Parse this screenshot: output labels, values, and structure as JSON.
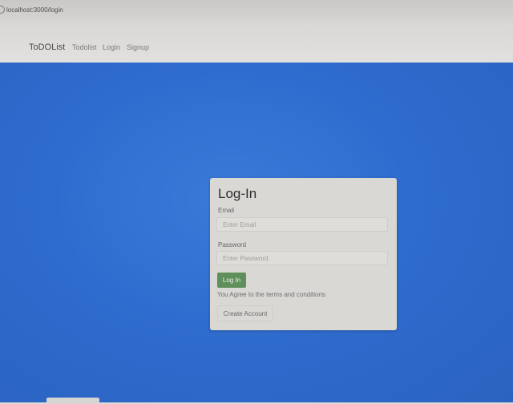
{
  "browser": {
    "url": "localhost:3000/login"
  },
  "navbar": {
    "brand": "ToDOList",
    "links": [
      {
        "label": "Todolist"
      },
      {
        "label": "Login"
      },
      {
        "label": "Signup"
      }
    ]
  },
  "login": {
    "title": "Log-In",
    "email_label": "Email",
    "email_placeholder": "Enter Email",
    "password_label": "Password",
    "password_placeholder": "Enter Password",
    "submit_label": "Log In",
    "terms_text": "You Agree to the terms and conditions",
    "create_account_label": "Create Account"
  },
  "colors": {
    "background_blue": "#2f6ccf",
    "card": "#d9d8d4",
    "login_button": "#5f8f5a"
  }
}
